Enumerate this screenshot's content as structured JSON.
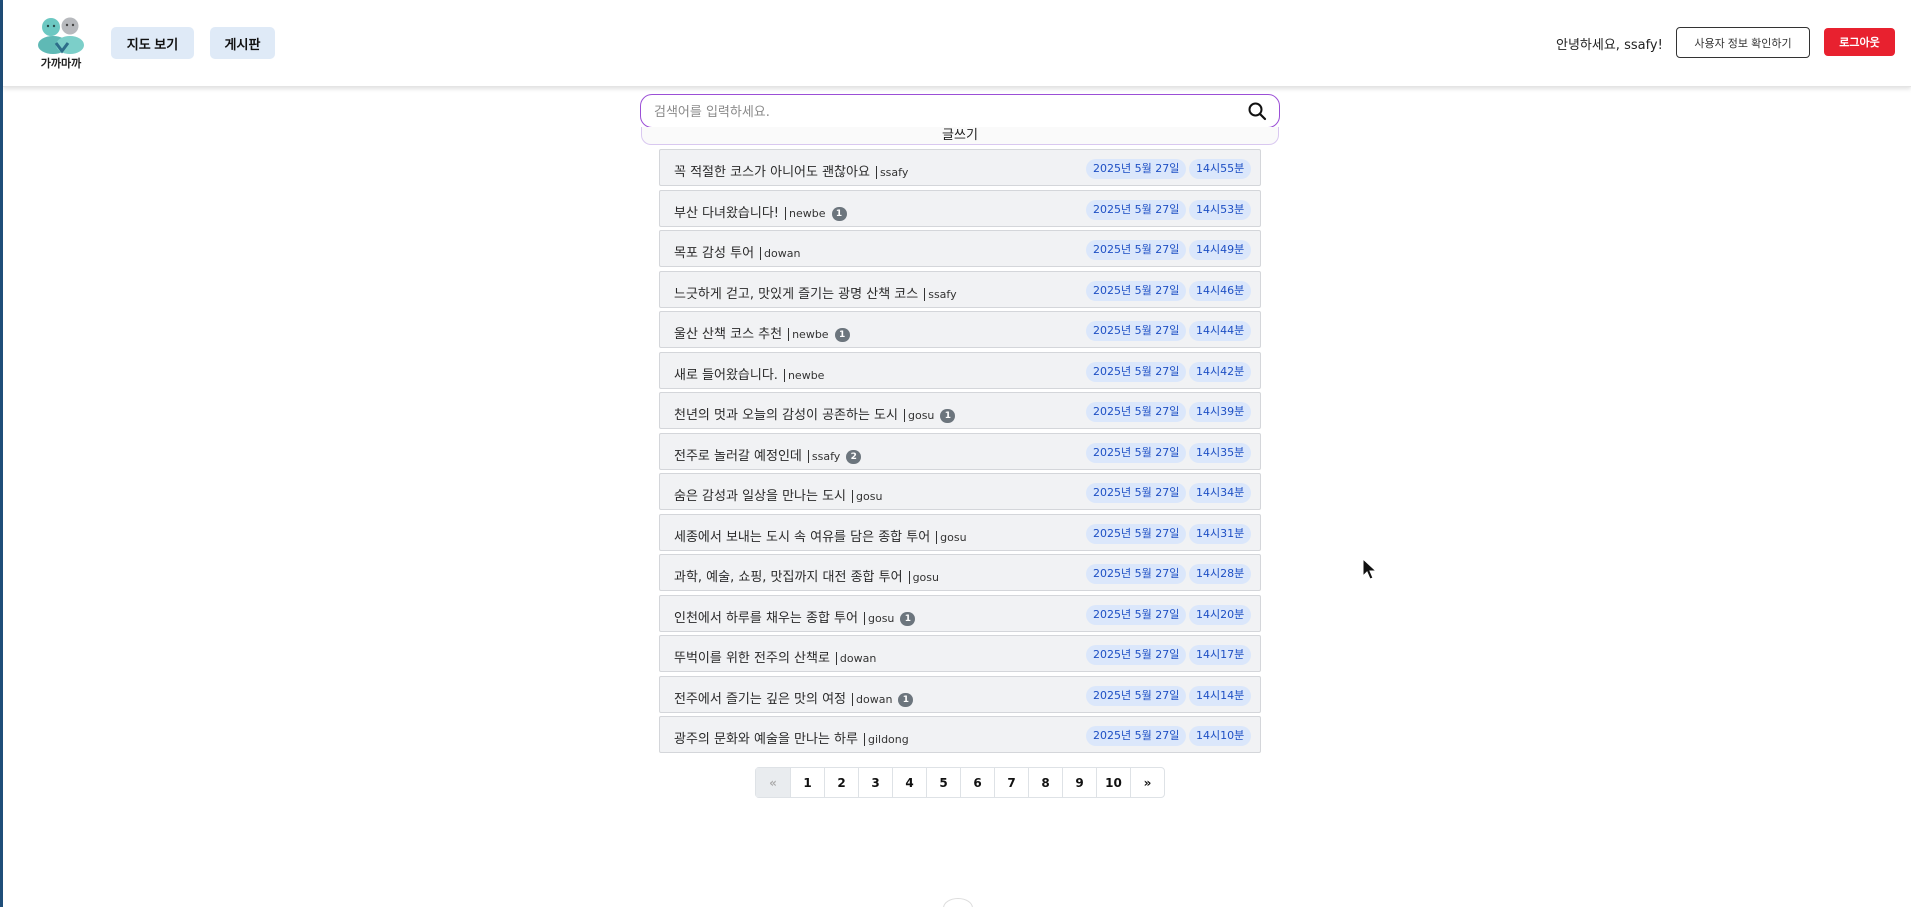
{
  "header": {
    "logo_text": "가까마까",
    "nav": [
      {
        "label": "지도 보기"
      },
      {
        "label": "게시판"
      }
    ],
    "greeting": "안녕하세요, ssafy!",
    "userinfo_label": "사용자 정보 확인하기",
    "logout_label": "로그아웃"
  },
  "search": {
    "placeholder": "검색어를 입력하세요.",
    "value": ""
  },
  "write_label": "글쓰기",
  "posts": [
    {
      "title": "꼭 적절한 코스가 아니어도 괜찮아요",
      "author": "ssafy",
      "comments": "",
      "date": "2025년 5월 27일",
      "time": "14시55분"
    },
    {
      "title": "부산 다녀왔습니다!",
      "author": "newbe",
      "comments": "1",
      "date": "2025년 5월 27일",
      "time": "14시53분"
    },
    {
      "title": "목포 감성 투어",
      "author": "dowan",
      "comments": "",
      "date": "2025년 5월 27일",
      "time": "14시49분"
    },
    {
      "title": "느긋하게 걷고, 맛있게 즐기는 광명 산책 코스",
      "author": "ssafy",
      "comments": "",
      "date": "2025년 5월 27일",
      "time": "14시46분"
    },
    {
      "title": "울산 산책 코스 추천",
      "author": "newbe",
      "comments": "1",
      "date": "2025년 5월 27일",
      "time": "14시44분"
    },
    {
      "title": "새로 들어왔습니다.",
      "author": "newbe",
      "comments": "",
      "date": "2025년 5월 27일",
      "time": "14시42분"
    },
    {
      "title": "천년의 멋과 오늘의 감성이 공존하는 도시",
      "author": "gosu",
      "comments": "1",
      "date": "2025년 5월 27일",
      "time": "14시39분"
    },
    {
      "title": "전주로 놀러갈 예정인데",
      "author": "ssafy",
      "comments": "2",
      "date": "2025년 5월 27일",
      "time": "14시35분"
    },
    {
      "title": "숨은 감성과 일상을 만나는 도시",
      "author": "gosu",
      "comments": "",
      "date": "2025년 5월 27일",
      "time": "14시34분"
    },
    {
      "title": "세종에서 보내는 도시 속 여유를 담은 종합 투어",
      "author": "gosu",
      "comments": "",
      "date": "2025년 5월 27일",
      "time": "14시31분"
    },
    {
      "title": "과학, 예술, 쇼핑, 맛집까지 대전 종합 투어",
      "author": "gosu",
      "comments": "",
      "date": "2025년 5월 27일",
      "time": "14시28분"
    },
    {
      "title": "인천에서 하루를 채우는 종합 투어",
      "author": "gosu",
      "comments": "1",
      "date": "2025년 5월 27일",
      "time": "14시20분"
    },
    {
      "title": "뚜벅이를 위한 전주의 산책로",
      "author": "dowan",
      "comments": "",
      "date": "2025년 5월 27일",
      "time": "14시17분"
    },
    {
      "title": "전주에서 즐기는 깊은 맛의 여정",
      "author": "dowan",
      "comments": "1",
      "date": "2025년 5월 27일",
      "time": "14시14분"
    },
    {
      "title": "광주의 문화와 예술을 만나는 하루",
      "author": "gildong",
      "comments": "",
      "date": "2025년 5월 27일",
      "time": "14시10분"
    }
  ],
  "pagination": [
    "«",
    "1",
    "2",
    "3",
    "4",
    "5",
    "6",
    "7",
    "8",
    "9",
    "10",
    "»"
  ],
  "colors": {
    "accent": "#9b4fd6",
    "nav_bg": "#dfeaf7",
    "logout": "#e8212f",
    "date_pill_bg": "#dbe7fb",
    "date_pill_text": "#1d4fc4"
  },
  "icons": {
    "search": "search-icon",
    "cursor": "mouse-pointer-icon"
  }
}
